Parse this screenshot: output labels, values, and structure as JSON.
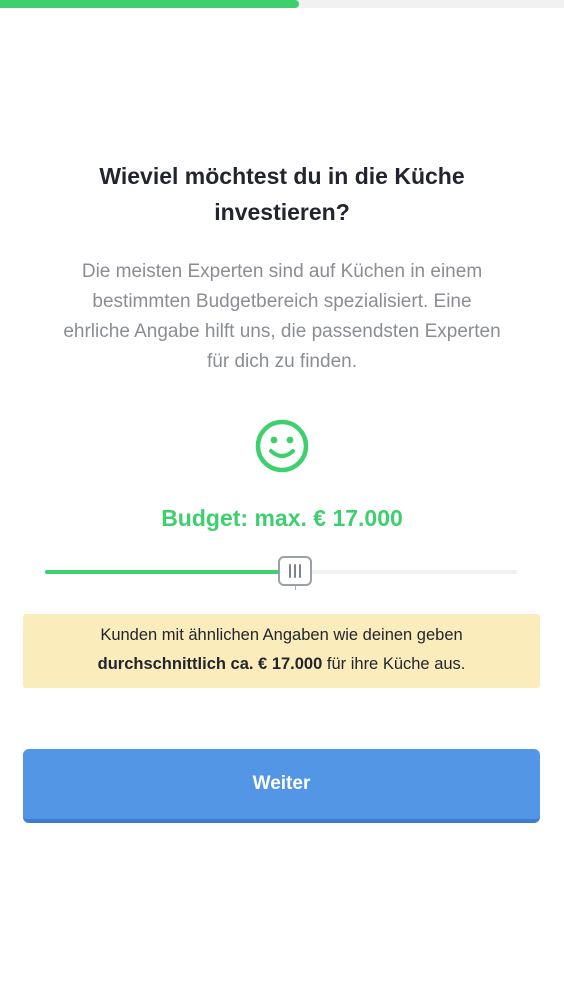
{
  "progress": {
    "fraction": 0.53,
    "color": "#3ecf6e"
  },
  "question": {
    "title_line1": "Wieviel möchtest du in die Küche",
    "title_line2": "investieren?",
    "subtitle_lines": [
      "Die meisten Experten sind auf Küchen in einem",
      "bestimmten Budgetbereich spezialisiert. Eine",
      "ehrliche Angabe hilft uns, die passendsten Experten",
      "für dich zu finden."
    ]
  },
  "mood": {
    "icon": "smiley-icon",
    "color": "#3ecf6e"
  },
  "budget": {
    "label": "Budget: max. € 17.000",
    "slider_fraction": 0.53
  },
  "info": {
    "line1": "Kunden mit ähnlichen Angaben wie deinen geben",
    "bold": "durchschnittlich ca. € 17.000",
    "rest": " für ihre Küche aus."
  },
  "actions": {
    "next_label": "Weiter"
  },
  "colors": {
    "accent_green": "#3ecf6e",
    "button_blue": "#5496e6",
    "info_background": "#fbecbb"
  }
}
